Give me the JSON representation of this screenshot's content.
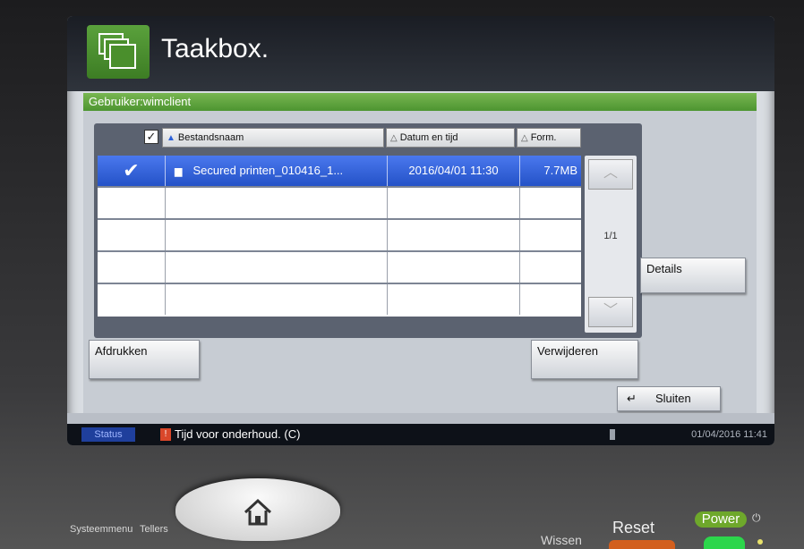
{
  "header": {
    "title": "Taakbox."
  },
  "user_bar": {
    "label": "Gebruiker:wimclient"
  },
  "columns": {
    "name": "Bestandsnaam",
    "date": "Datum en tijd",
    "size": "Form."
  },
  "rows": [
    {
      "name": "Secured printen_010416_1...",
      "date": "2016/04/01 11:30",
      "size": "7.7MB",
      "selected": true
    }
  ],
  "pagination": {
    "indicator": "1/1"
  },
  "buttons": {
    "details": "Details",
    "print": "Afdrukken",
    "delete": "Verwijderen",
    "close": "Sluiten"
  },
  "status": {
    "label": "Status",
    "message": "Tijd voor onderhoud. (C)",
    "datetime": "01/04/2016 11:41"
  },
  "hardware": {
    "system_menu": "Systeemmenu",
    "counters": "Tellers",
    "clear": "Wissen",
    "reset": "Reset",
    "power": "Power"
  },
  "colors": {
    "accent_green": "#4d9531",
    "selection_blue": "#2452c7",
    "status_blue": "#1f3f9c"
  }
}
